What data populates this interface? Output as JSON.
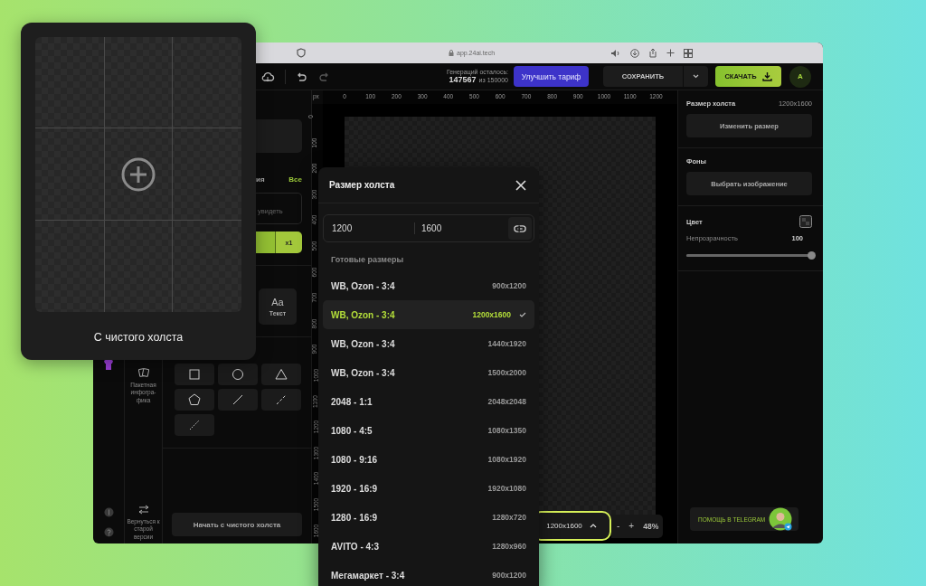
{
  "browser": {
    "address": "app.24ai.tech"
  },
  "topbar": {
    "generations_label": "Генераций осталось:",
    "generations_count": "147567",
    "generations_total": "из 150000",
    "upgrade_button": "Улучшить тариф",
    "save_button": "СОХРАНИТЬ",
    "download_button": "СКАЧАТЬ",
    "avatar": "A"
  },
  "left_panel": {
    "section_title": "ия",
    "all_link": "Все",
    "field_placeholder": "увидеть",
    "generate_count": "x1",
    "text_tool": {
      "icon": "Aa",
      "label": "Текст"
    },
    "batch_label": "Пакетная инфогра-фика",
    "back_label": "Вернуться к старой версии",
    "start_button": "Начать с чистого холста",
    "shapes": [
      {
        "kind": "square"
      },
      {
        "kind": "circle"
      },
      {
        "kind": "triangle"
      },
      {
        "kind": "pentagon"
      },
      {
        "kind": "line"
      },
      {
        "kind": "dashed"
      },
      {
        "kind": "dotted"
      }
    ]
  },
  "ruler": {
    "unit": "px",
    "x_ticks": [
      "0",
      "100",
      "200",
      "300",
      "400",
      "500",
      "600",
      "700",
      "800",
      "900",
      "1000",
      "1100",
      "1200"
    ],
    "y_ticks": [
      "0",
      "100",
      "200",
      "300",
      "400",
      "500",
      "600",
      "700",
      "800",
      "900",
      "1000",
      "1100",
      "1200",
      "1300",
      "1400",
      "1500",
      "1600"
    ]
  },
  "canvas_bar": {
    "size": "1200x1600",
    "zoom_out": "-",
    "zoom_in": "+",
    "zoom": "48%"
  },
  "right_panel": {
    "size_label": "Размер холста",
    "size_value": "1200x1600",
    "resize_button": "Изменить размер",
    "backgrounds_label": "Фоны",
    "choose_image_button": "Выбрать изображение",
    "color_label": "Цвет",
    "opacity": {
      "label": "Непрозрачность",
      "value": "100",
      "level": 1
    },
    "help_button": "ПОМОЩЬ В TELEGRAM"
  },
  "start_card": {
    "label": "С чистого холста"
  },
  "size_popup": {
    "title": "Размер холста",
    "width_field": "1200",
    "height_field": "1600",
    "presets_title": "Готовые размеры",
    "presets": [
      {
        "name": "WB, Ozon - 3:4",
        "size": "900x1200",
        "selected": false
      },
      {
        "name": "WB, Ozon - 3:4",
        "size": "1200x1600",
        "selected": true
      },
      {
        "name": "WB, Ozon - 3:4",
        "size": "1440x1920",
        "selected": false
      },
      {
        "name": "WB, Ozon - 3:4",
        "size": "1500x2000",
        "selected": false
      },
      {
        "name": "2048 - 1:1",
        "size": "2048x2048",
        "selected": false
      },
      {
        "name": "1080 - 4:5",
        "size": "1080x1350",
        "selected": false
      },
      {
        "name": "1080 - 9:16",
        "size": "1080x1920",
        "selected": false
      },
      {
        "name": "1920 - 16:9",
        "size": "1920x1080",
        "selected": false
      },
      {
        "name": "1280 - 16:9",
        "size": "1280x720",
        "selected": false
      },
      {
        "name": "AVITO - 4:3",
        "size": "1280x960",
        "selected": false
      },
      {
        "name": "Мегамаркет - 3:4",
        "size": "900x1200",
        "selected": false
      }
    ]
  }
}
